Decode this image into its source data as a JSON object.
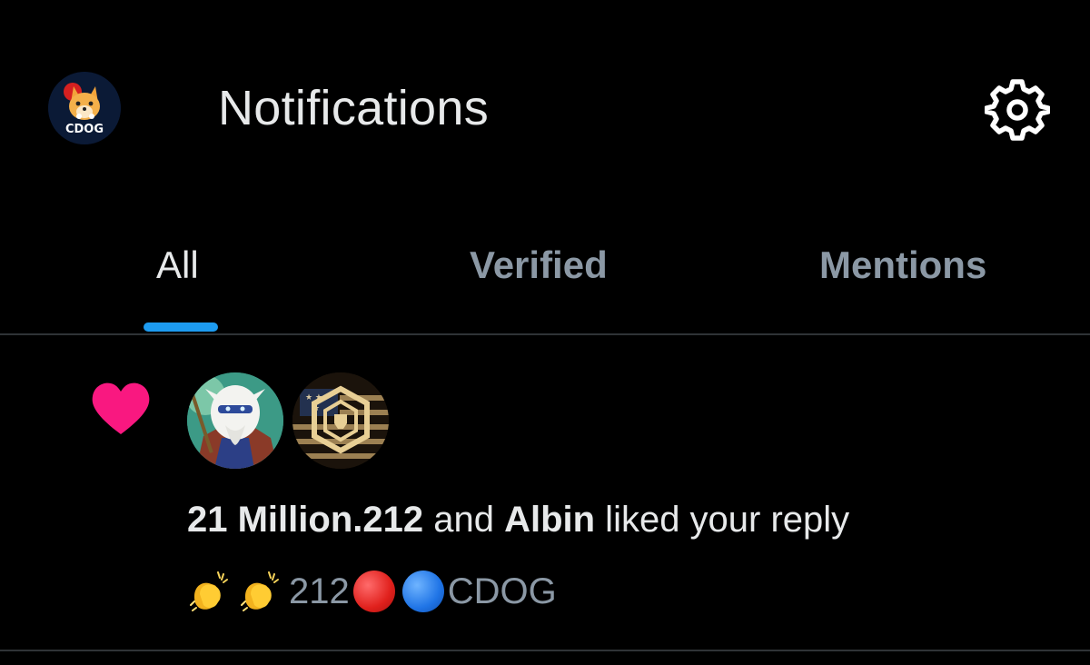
{
  "header": {
    "title": "Notifications",
    "avatar_label": "CDOG",
    "settings_icon": "gear-icon"
  },
  "tabs": [
    {
      "label": "All",
      "active": true
    },
    {
      "label": "Verified",
      "active": false
    },
    {
      "label": "Mentions",
      "active": false
    }
  ],
  "colors": {
    "background": "#000000",
    "text": "#e7e9ea",
    "muted": "#8b98a5",
    "accent": "#1d9bf0",
    "like": "#f91880",
    "divider": "#2f3336"
  },
  "notification": {
    "type_icon": "heart-icon",
    "user1": "21 Million.212",
    "conjunction": " and ",
    "user2": "Albin",
    "action": " liked your reply",
    "reply": {
      "emoji": [
        "clapping-hands",
        "clapping-hands",
        "red-circle",
        "blue-circle"
      ],
      "number": "212",
      "suffix": "CDOG"
    }
  }
}
